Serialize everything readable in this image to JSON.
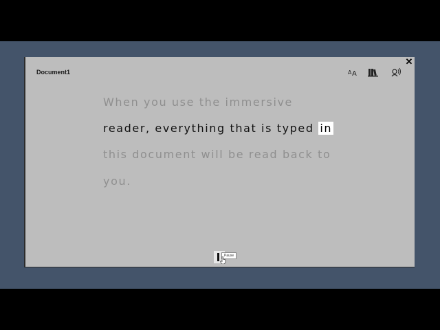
{
  "window": {
    "title": "Document1"
  },
  "toolbar": {
    "text_preferences_icon": "text-preferences-icon",
    "grammar_options_icon": "grammar-options-icon",
    "voice_settings_icon": "voice-settings-icon",
    "close_label": "✕"
  },
  "reader": {
    "lines": [
      {
        "before": "When you use the immersive",
        "highlight": "",
        "after": ""
      },
      {
        "before": "reader, everything that is typed ",
        "highlight": "in",
        "after": ""
      },
      {
        "before": "this document will be read back to",
        "highlight": "",
        "after": ""
      },
      {
        "before": "you.",
        "highlight": "",
        "after": ""
      }
    ]
  },
  "playback": {
    "tooltip": "Pause"
  },
  "colors": {
    "stage": "#44546a",
    "panel": "#bdbdbd",
    "highlight": "#ffffff",
    "dim_text": "#8f8f8f"
  }
}
